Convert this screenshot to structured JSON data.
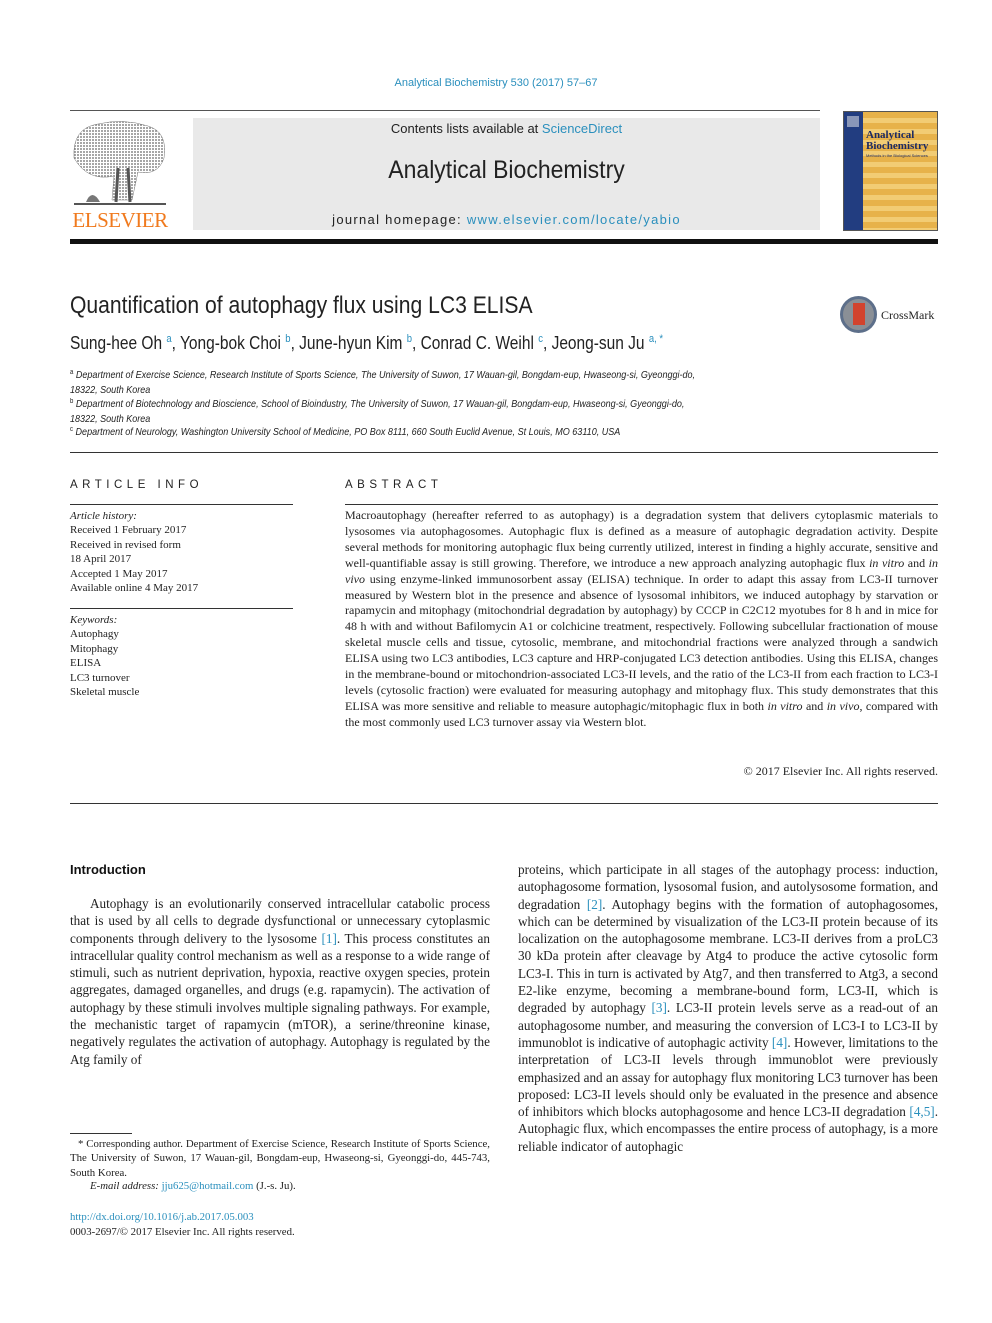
{
  "journal_reference": "Analytical Biochemistry 530 (2017) 57–67",
  "header": {
    "publisher_logo_text": "ELSEVIER",
    "contents_prefix": "Contents lists available at ",
    "contents_link": "ScienceDirect",
    "journal_title": "Analytical Biochemistry",
    "homepage_prefix": "journal homepage: ",
    "homepage_link": "www.elsevier.com/locate/yabio",
    "cover": {
      "title_line1": "Analytical",
      "title_line2": "Biochemistry",
      "subtitle": "Methods in the Biological Sciences"
    }
  },
  "article": {
    "title": "Quantification of autophagy flux using LC3 ELISA",
    "crossmark_label": "CrossMark",
    "authors": [
      {
        "name": "Sung-hee Oh",
        "sup": "a"
      },
      {
        "name": "Yong-bok Choi",
        "sup": "b"
      },
      {
        "name": "June-hyun Kim",
        "sup": "b"
      },
      {
        "name": "Conrad C. Weihl",
        "sup": "c"
      },
      {
        "name": "Jeong-sun Ju",
        "sup": "a, *"
      }
    ],
    "affiliations": [
      {
        "sup": "a",
        "line1": "Department of Exercise Science, Research Institute of Sports Science, The University of Suwon, 17 Wauan-gil, Bongdam-eup, Hwaseong-si, Gyeonggi-do,",
        "line2": "18322, South Korea"
      },
      {
        "sup": "b",
        "line1": "Department of Biotechnology and Bioscience, School of Bioindustry, The University of Suwon, 17 Wauan-gil, Bongdam-eup, Hwaseong-si, Gyeonggi-do,",
        "line2": "18322, South Korea"
      },
      {
        "sup": "c",
        "line1": "Department of Neurology, Washington University School of Medicine, PO Box 8111, 660 South Euclid Avenue, St Louis, MO 63110, USA"
      }
    ]
  },
  "article_info": {
    "heading": "ARTICLE INFO",
    "history_label": "Article history:",
    "history": [
      "Received 1 February 2017",
      "Received in revised form",
      "18 April 2017",
      "Accepted 1 May 2017",
      "Available online 4 May 2017"
    ],
    "keywords_label": "Keywords:",
    "keywords": [
      "Autophagy",
      "Mitophagy",
      "ELISA",
      "LC3 turnover",
      "Skeletal muscle"
    ]
  },
  "abstract": {
    "heading": "ABSTRACT",
    "part1": "Macroautophagy (hereafter referred to as autophagy) is a degradation system that delivers cytoplasmic materials to lysosomes via autophagosomes. Autophagic flux is defined as a measure of autophagic degradation activity. Despite several methods for monitoring autophagic flux being currently utilized, interest in finding a highly accurate, sensitive and well-quantifiable assay is still growing. Therefore, we introduce a new approach analyzing autophagic flux ",
    "italic1": "in vitro",
    "part2": " and ",
    "italic2": "in vivo",
    "part3": " using enzyme-linked immunosorbent assay (ELISA) technique. In order to adapt this assay from LC3-II turnover measured by Western blot in the presence and absence of lysosomal inhibitors, we induced autophagy by starvation or rapamycin and mitophagy (mitochondrial degradation by autophagy) by CCCP in C2C12 myotubes for 8 h and in mice for 48 h with and without Bafilomycin A1 or colchicine treatment, respectively. Following subcellular fractionation of mouse skeletal muscle cells and tissue, cytosolic, membrane, and mitochondrial fractions were analyzed through a sandwich ELISA using two LC3 antibodies, LC3 capture and HRP-conjugated LC3 detection antibodies. Using this ELISA, changes in the membrane-bound or mitochondrion-associated LC3-II levels, and the ratio of the LC3-II from each fraction to LC3-I levels (cytosolic fraction) were evaluated for measuring autophagy and mitophagy flux. This study demonstrates that this ELISA was more sensitive and reliable to measure autophagic/mitophagic flux in both ",
    "italic3": "in vitro",
    "part4": " and ",
    "italic4": "in vivo",
    "part5": ", compared with the most commonly used LC3 turnover assay via Western blot.",
    "copyright": "© 2017 Elsevier Inc. All rights reserved."
  },
  "introduction": {
    "heading": "Introduction",
    "left": {
      "t1": "Autophagy is an evolutionarily conserved intracellular catabolic process that is used by all cells to degrade dysfunctional or unnecessary cytoplasmic components through delivery to the lysosome ",
      "ref1": "[1]",
      "t2": ". This process constitutes an intracellular quality control mechanism as well as a response to a wide range of stimuli, such as nutrient deprivation, hypoxia, reactive oxygen species, protein aggregates, damaged organelles, and drugs (e.g. rapamycin). The activation of autophagy by these stimuli involves multiple signaling pathways. For example, the mechanistic target of rapamycin (mTOR), a serine/threonine kinase, negatively regulates the activation of autophagy. Autophagy is regulated by the Atg family of"
    },
    "right": {
      "t1": "proteins, which participate in all stages of the autophagy process: induction, autophagosome formation, lysosomal fusion, and autolysosome formation, and degradation ",
      "ref2": "[2]",
      "t2": ". Autophagy begins with the formation of autophagosomes, which can be determined by visualization of the LC3-II protein because of its localization on the autophagosome membrane. LC3-II derives from a proLC3 30 kDa protein after cleavage by Atg4 to produce the active cytosolic form LC3-I. This in turn is activated by Atg7, and then transferred to Atg3, a second E2-like enzyme, becoming a membrane-bound form, LC3-II, which is degraded by autophagy ",
      "ref3": "[3]",
      "t3": ". LC3-II protein levels serve as a read-out of an autophagosome number, and measuring the conversion of LC3-I to LC3-II by immunoblot is indicative of autophagic activity ",
      "ref4": "[4]",
      "t4": ". However, limitations to the interpretation of LC3-II levels through immunoblot were previously emphasized and an assay for autophagy flux monitoring LC3 turnover has been proposed: LC3-II levels should only be evaluated in the presence and absence of inhibitors which blocks autophagosome and hence LC3-II degradation ",
      "ref45": "[4,5]",
      "t5": ". Autophagic flux, which encompasses the entire process of autophagy, is a more reliable indicator of autophagic"
    }
  },
  "footnote": {
    "corresponding": "* Corresponding author. Department of Exercise Science, Research Institute of Sports Science, The University of Suwon, 17 Wauan-gil, Bongdam-eup, Hwaseong-si, Gyeonggi-do, 445-743, South Korea.",
    "email_label": "E-mail address: ",
    "email": "jju625@hotmail.com",
    "email_suffix": " (J.-s. Ju).",
    "doi": "http://dx.doi.org/10.1016/j.ab.2017.05.003",
    "issn": "0003-2697/© 2017 Elsevier Inc. All rights reserved."
  }
}
